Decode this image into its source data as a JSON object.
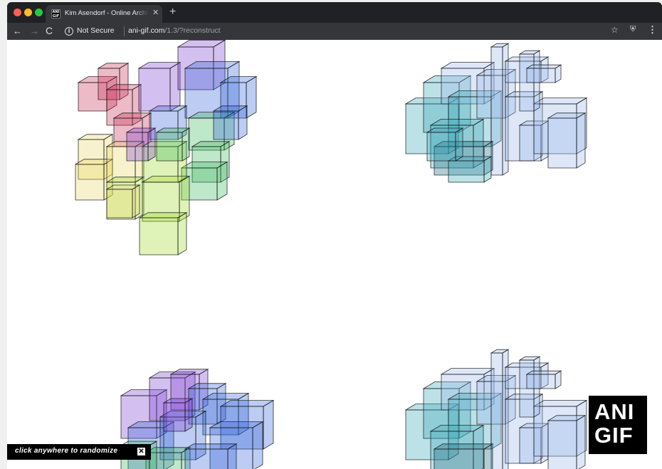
{
  "browser": {
    "tab": {
      "favicon_text": "ANI GIF",
      "title": "Kim Asendorf - Online Architecture",
      "close_glyph": "✕"
    },
    "new_tab_glyph": "+",
    "nav": {
      "back": "←",
      "forward": "→",
      "reload": "C"
    },
    "address": {
      "info_glyph": "i",
      "security_label": "Not Secure",
      "url_host": "ani-gif.com",
      "url_path": "/1.3/?reconstruct"
    },
    "icons": {
      "star": "☆",
      "extension": "⛨",
      "menu": "⋮"
    }
  },
  "page": {
    "logo": {
      "line1": "ANI",
      "line2": "GIF"
    },
    "hint": {
      "text": "click anywhere to randomize",
      "close": "✕"
    },
    "colors": {
      "rainbow": [
        "#c82850",
        "#7a3ad0",
        "#2f5fd8",
        "#38b45a",
        "#9ad820",
        "#e8d860"
      ],
      "teal": "#3aa6b8",
      "lightblue": "#9ab8ea",
      "dark_teal": "#1e6a80"
    }
  }
}
